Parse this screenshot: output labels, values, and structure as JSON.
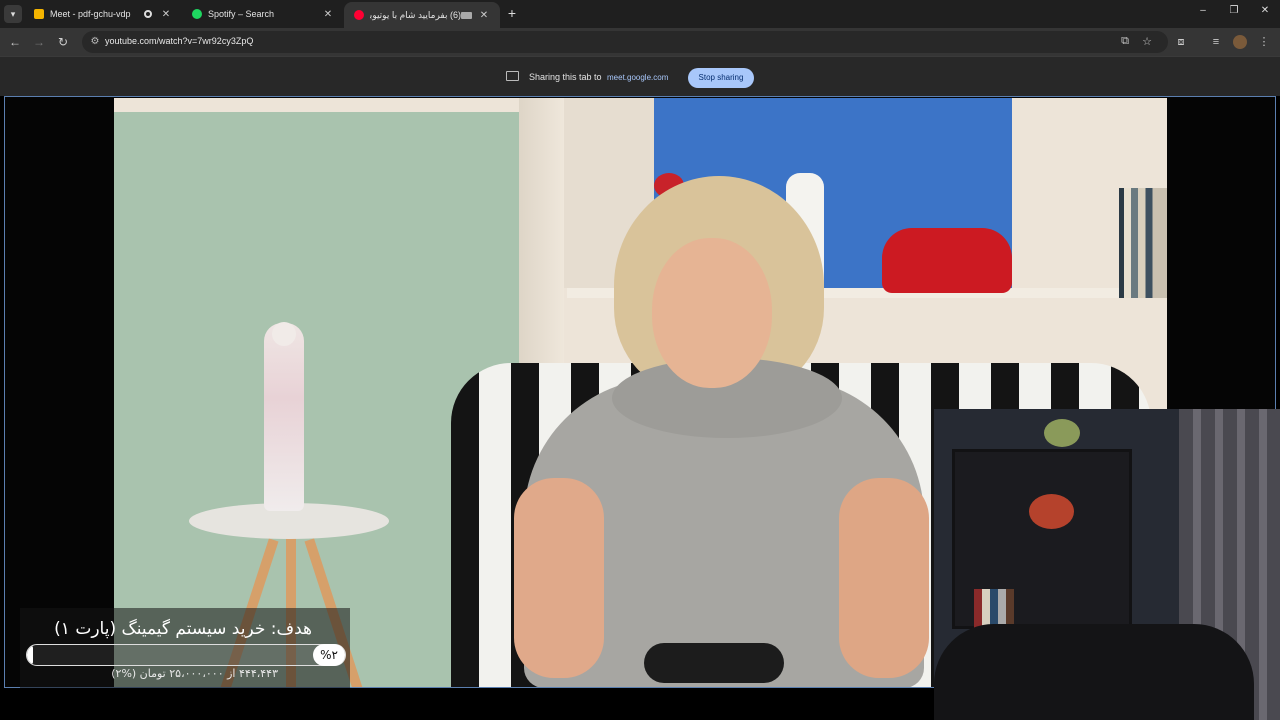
{
  "browser": {
    "tabs": [
      {
        "label": "Meet - pdf-gchu-vdp",
        "favicon_color": "#f4b400",
        "recording": true
      },
      {
        "label": "Spotify – Search",
        "favicon_color": "#1ed760"
      },
      {
        "label": "(6) بفرمایید شام با یوتیوبرا (...",
        "favicon_color": "#ff0033",
        "active": true
      }
    ],
    "new_tab": "+",
    "window_controls": {
      "minimize": "–",
      "maximize": "❐",
      "close": "✕"
    },
    "tab_close": "✕",
    "url": "youtube.com/watch?v=7wr92cy3ZpQ",
    "nav": {
      "back": "←",
      "forward": "→",
      "reload": "↻",
      "site_info": "⚙"
    },
    "toolbar_icons": {
      "cast": "⧉",
      "bookmark": "☆",
      "extensions": "⧈",
      "media": "≡",
      "menu": "⋮"
    }
  },
  "share_bar": {
    "text": "Sharing this tab to",
    "host": "meet.google.com",
    "stop_label": "Stop sharing"
  },
  "overlay": {
    "goal_title": "هدف: خرید سیستم گیمینگ (پارت ۱)",
    "goal_badge": "%۲",
    "goal_subtitle": "۴۴۴،۴۴۳ از ۲۵،۰۰۰،۰۰۰ تومان (%۲)",
    "progress_fraction": 0.02
  },
  "colors": {
    "accent": "#a8c7fa",
    "tabstrip": "#1f1f1f",
    "toolbar": "#353535"
  }
}
